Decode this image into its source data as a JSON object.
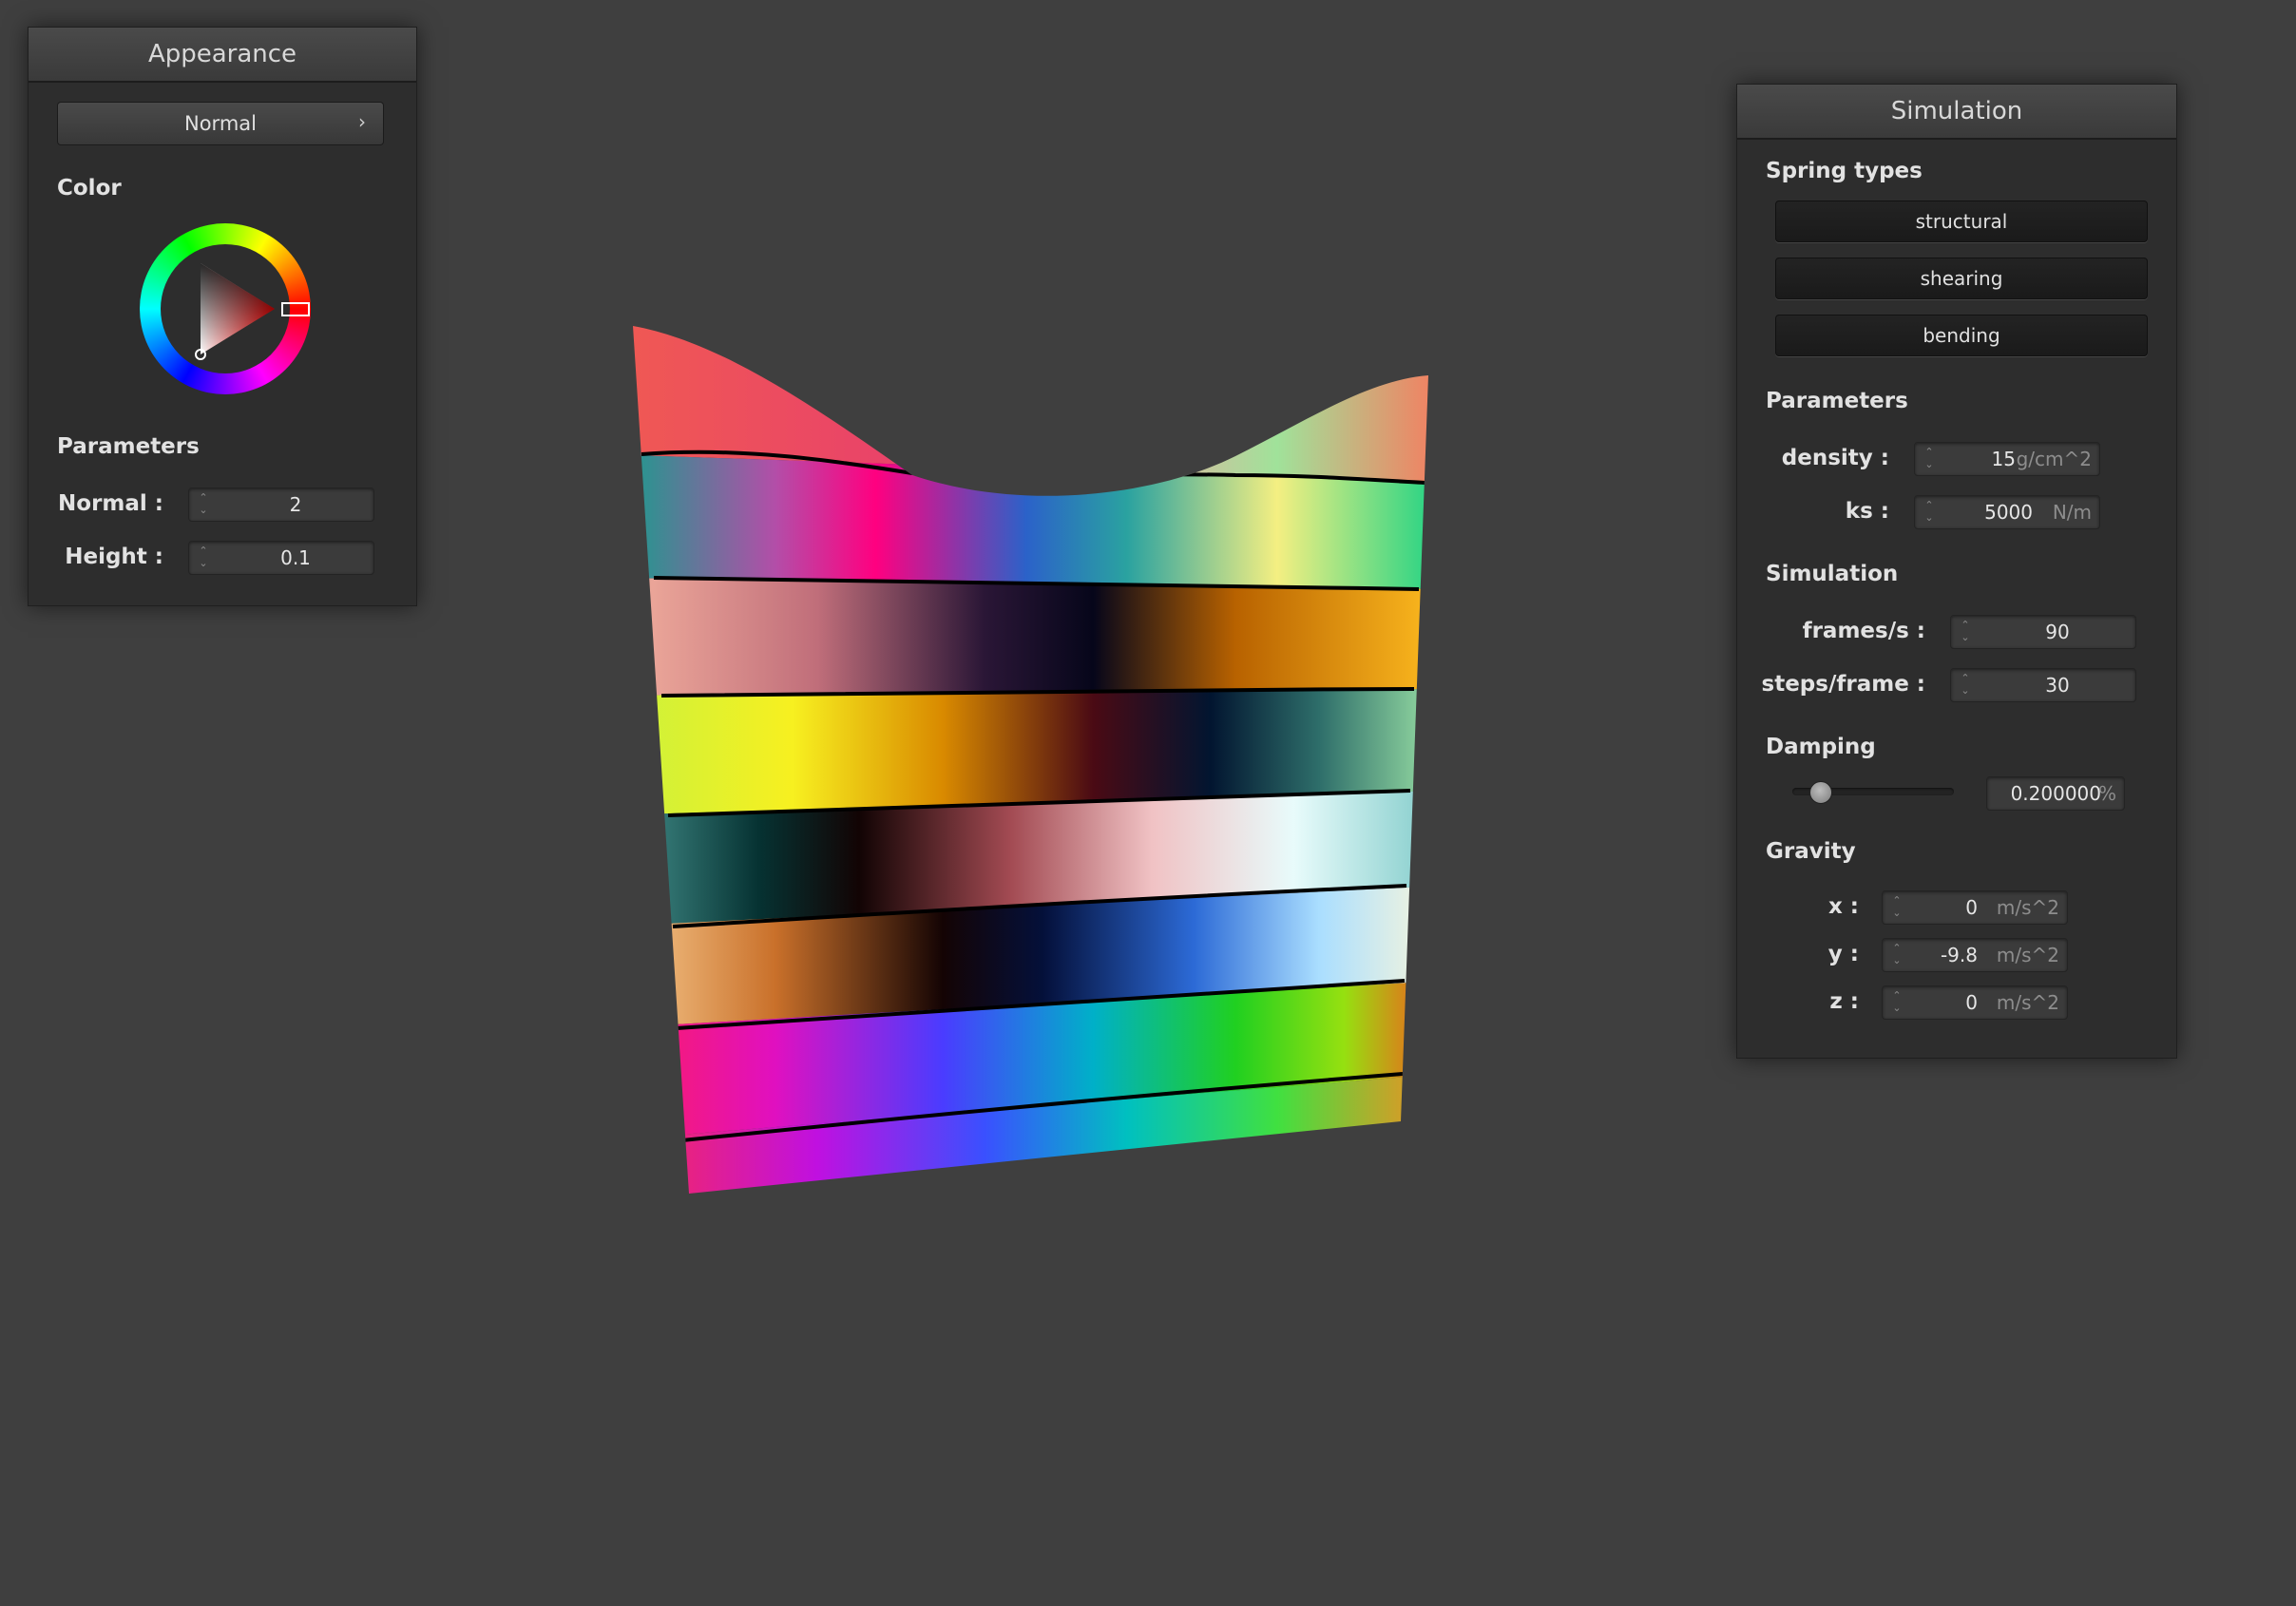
{
  "appearance": {
    "title": "Appearance",
    "mode_button": "Normal",
    "color_label": "Color",
    "parameters_label": "Parameters",
    "normal_label": "Normal :",
    "normal_value": "2",
    "height_label": "Height :",
    "height_value": "0.1",
    "selected_color": "#ff0000"
  },
  "simulation_panel": {
    "title": "Simulation",
    "spring_types_label": "Spring types",
    "springs": [
      "structural",
      "shearing",
      "bending"
    ],
    "parameters_label": "Parameters",
    "density_label": "density :",
    "density_value": "15",
    "density_unit": "g/cm^2",
    "ks_label": "ks :",
    "ks_value": "5000",
    "ks_unit": "N/m",
    "simulation_label": "Simulation",
    "fps_label": "frames/s :",
    "fps_value": "90",
    "steps_label": "steps/frame :",
    "steps_value": "30",
    "damping_label": "Damping",
    "damping_value": "0.200000",
    "damping_unit": "%",
    "damping_fraction": 0.2,
    "gravity_label": "Gravity",
    "gx_label": "x :",
    "gx_value": "0",
    "gy_label": "y :",
    "gy_value": "-9.8",
    "gz_label": "z :",
    "gz_value": "0",
    "gravity_unit": "m/s^2"
  },
  "colors": {
    "background": "#3f3f3f",
    "panel": "#2d2d2d"
  }
}
